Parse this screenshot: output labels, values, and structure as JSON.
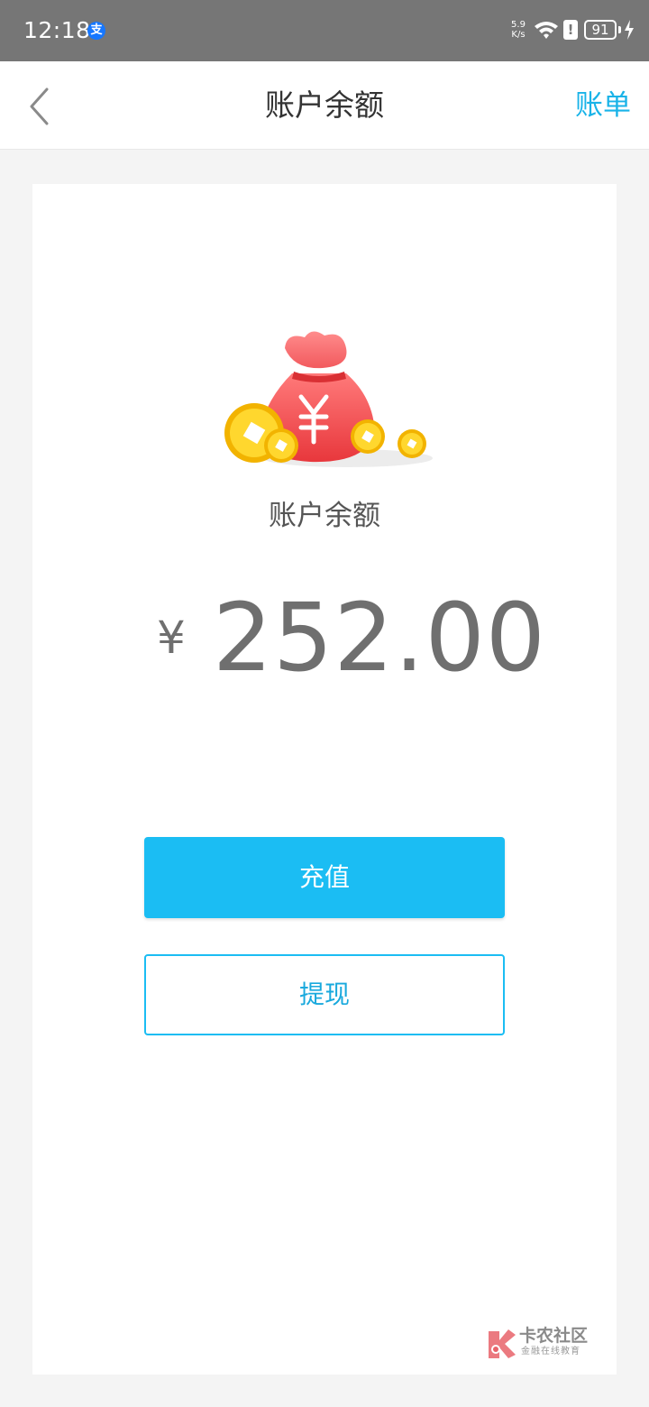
{
  "status_bar": {
    "time": "12:18",
    "app_badge": "支",
    "net_speed_value": "5.9",
    "net_speed_unit": "K/s",
    "alert_glyph": "!",
    "battery_level": "91",
    "icons": [
      "alipay-icon",
      "wifi-icon",
      "alert-icon",
      "battery-icon",
      "charging-icon"
    ]
  },
  "header": {
    "title": "账户余额",
    "right_action": "账单",
    "back_icon": "chevron-left-icon"
  },
  "balance": {
    "label": "账户余额",
    "currency": "¥",
    "amount": "252.00"
  },
  "actions": {
    "recharge_label": "充值",
    "withdraw_label": "提现"
  },
  "watermark": {
    "name": "卡农社区",
    "subtitle": "金融在线教育"
  },
  "colors": {
    "accent": "#1bbdf3",
    "accent_text": "#19b3e8",
    "status_bar_bg": "#767676",
    "page_bg": "#f4f4f4",
    "card_bg": "#ffffff",
    "amount_text": "#6f6f6f",
    "bag_red": "#ef4b4f",
    "coin_gold": "#f6c718"
  }
}
